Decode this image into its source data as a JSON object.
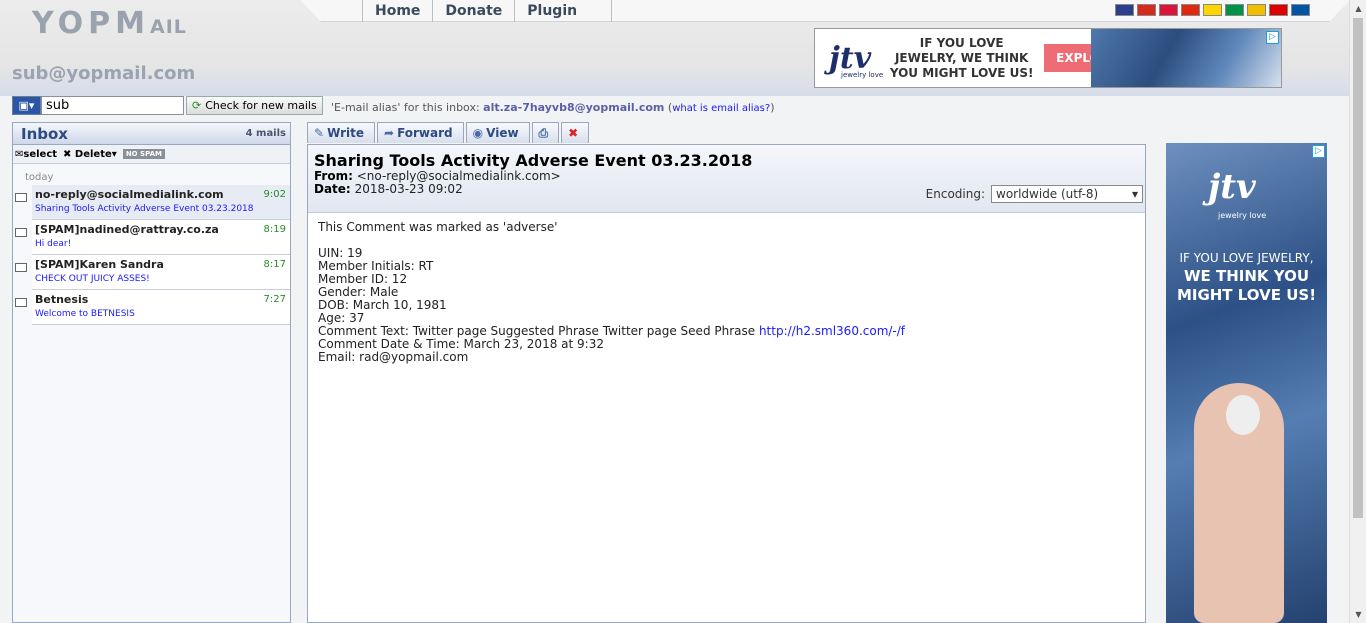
{
  "brand": {
    "logo_main": "YOPM",
    "logo_small": "AIL"
  },
  "header": {
    "email": "sub@yopmail.com"
  },
  "nav": [
    {
      "label": "Home"
    },
    {
      "label": "Donate"
    },
    {
      "label": "Plugin"
    }
  ],
  "flags": [
    {
      "name": "uk-flag",
      "color": "#2b3f8c"
    },
    {
      "name": "russia-flag",
      "color": "#d52b1e"
    },
    {
      "name": "poland-flag",
      "color": "#dc143c"
    },
    {
      "name": "china-flag",
      "color": "#de2910"
    },
    {
      "name": "ukraine-flag",
      "color": "#ffd500"
    },
    {
      "name": "italy-flag",
      "color": "#009246"
    },
    {
      "name": "spain-flag",
      "color": "#f1bf00"
    },
    {
      "name": "germany-flag",
      "color": "#dd0000"
    },
    {
      "name": "france-flag",
      "color": "#0055a4"
    }
  ],
  "ad_top": {
    "brand": "jtv",
    "brand_sub": "jewelry love",
    "message": "IF YOU LOVE JEWELRY, WE THINK YOU MIGHT LOVE US!",
    "cta": "EXPLORE JTV"
  },
  "toolbar": {
    "login_value": "sub",
    "check_label": "Check for new mails"
  },
  "alias": {
    "prefix": "'E-mail alias' for this inbox:",
    "address": "alt.za-7hayvb8@yopmail.com",
    "help_link": "what is email alias?"
  },
  "inbox": {
    "title": "Inbox",
    "count": "4 mails",
    "actions": {
      "select": "select",
      "delete": "Delete",
      "nospam": "NO SPAM"
    },
    "day": "today",
    "mails": [
      {
        "from": "no-reply@socialmedialink.com",
        "time": "9:02",
        "subject": "Sharing Tools Activity Adverse Event 03.23.2018"
      },
      {
        "from": "[SPAM]nadined@rattray.co.za",
        "time": "8:19",
        "subject": "Hi dear!"
      },
      {
        "from": "[SPAM]Karen Sandra",
        "time": "8:17",
        "subject": "CHECK OUT JUICY ASSES!"
      },
      {
        "from": "Betnesis",
        "time": "7:27",
        "subject": "Welcome to BETNESIS"
      }
    ]
  },
  "tabs": {
    "write": "Write",
    "forward": "Forward",
    "view": "View"
  },
  "mail": {
    "title": "Sharing Tools Activity Adverse Event 03.23.2018",
    "from_label": "From:",
    "from": "<no-reply@socialmedialink.com>",
    "date_label": "Date:",
    "date": "2018-03-23 09:02",
    "encoding_label": "Encoding:",
    "encoding": "worldwide (utf-8)",
    "body": {
      "intro": "This Comment was marked as 'adverse'",
      "uin": "UIN: 19",
      "initials": "Member Initials: RT",
      "member_id": "Member ID: 12",
      "gender": "Gender: Male",
      "dob": "DOB: March 10, 1981",
      "age": "Age: 37",
      "comment_prefix": "Comment Text: Twitter page Suggested Phrase Twitter page Seed Phrase ",
      "comment_link": "http://h2.sml360.com/-/f",
      "comment_date": "Comment Date & Time: March 23, 2018 at 9:32",
      "email": "Email: rad@yopmail.com"
    }
  },
  "ad_side": {
    "brand": "jtv",
    "brand_sub": "jewelry love",
    "line1": "IF YOU LOVE JEWELRY,",
    "line2": "WE THINK YOU MIGHT LOVE US!"
  }
}
